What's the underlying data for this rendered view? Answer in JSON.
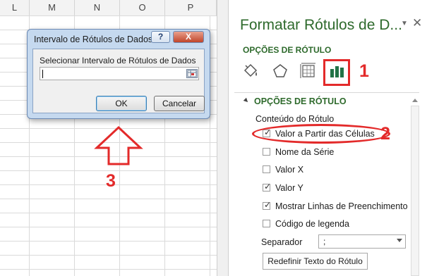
{
  "sheet": {
    "columns": [
      "L",
      "M",
      "N",
      "O",
      "P"
    ]
  },
  "dialog": {
    "title": "Intervalo de Rótulos de Dados",
    "help_label": "?",
    "close_label": "X",
    "prompt": "Selecionar Intervalo de Rótulos de Dados",
    "input_value": "",
    "ok_label": "OK",
    "cancel_label": "Cancelar"
  },
  "pane": {
    "title": "Formatar Rótulos de D...",
    "dropdown_icon": "chevron-down-icon",
    "close_icon": "close-icon",
    "section_label": "OPÇÕES DE RÓTULO",
    "tabs": [
      {
        "icon": "paint-bucket-icon"
      },
      {
        "icon": "pentagon-icon"
      },
      {
        "icon": "size-properties-icon"
      },
      {
        "icon": "bar-chart-icon"
      }
    ],
    "section_header": "OPÇÕES DE RÓTULO",
    "content_label": "Conteúdo do Rótulo",
    "checkboxes": [
      {
        "label": "Valor a Partir das Células",
        "checked": true
      },
      {
        "label": "Nome da Série",
        "checked": false
      },
      {
        "label": "Valor X",
        "checked": false
      },
      {
        "label": "Valor Y",
        "checked": true
      },
      {
        "label": "Mostrar Linhas de Preenchimento",
        "checked": true
      },
      {
        "label": "Código de legenda",
        "checked": false
      }
    ],
    "separator_label": "Separador",
    "separator_value": ";",
    "reset_button": "Redefinir Texto do Rótulo"
  },
  "annotations": {
    "one": "1",
    "two": "2",
    "three": "3"
  },
  "colors": {
    "accent_green": "#2e6a2c",
    "annotation_red": "#e32a2a",
    "chart_icon_green": "#217346"
  }
}
